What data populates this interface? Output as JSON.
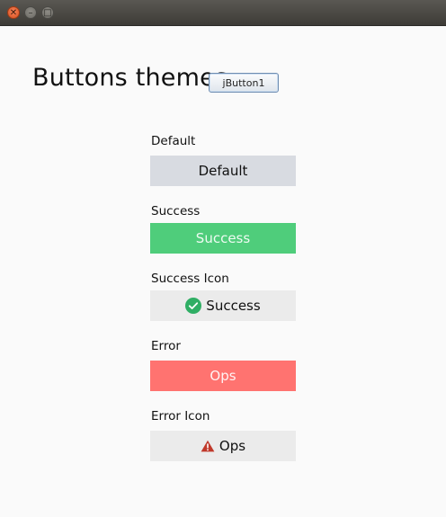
{
  "window": {
    "controls": [
      "close-icon",
      "minimize-icon",
      "maximize-icon"
    ]
  },
  "header": {
    "title": "Buttons themes",
    "jbutton_label": "jButton1"
  },
  "sections": [
    {
      "label": "Default",
      "button": "Default",
      "theme": "default",
      "color": "#d8dbe1"
    },
    {
      "label": "Success",
      "button": "Success",
      "theme": "success",
      "color": "#4fcd7b"
    },
    {
      "label": "Success Icon",
      "button": "Success",
      "theme": "success-icon",
      "icon": "check-circle-icon",
      "icon_color": "#2fae64"
    },
    {
      "label": "Error",
      "button": "Ops",
      "theme": "error",
      "color": "#ff7370"
    },
    {
      "label": "Error Icon",
      "button": "Ops",
      "theme": "error-icon",
      "icon": "warning-triangle-icon",
      "icon_color": "#c0392b"
    }
  ]
}
